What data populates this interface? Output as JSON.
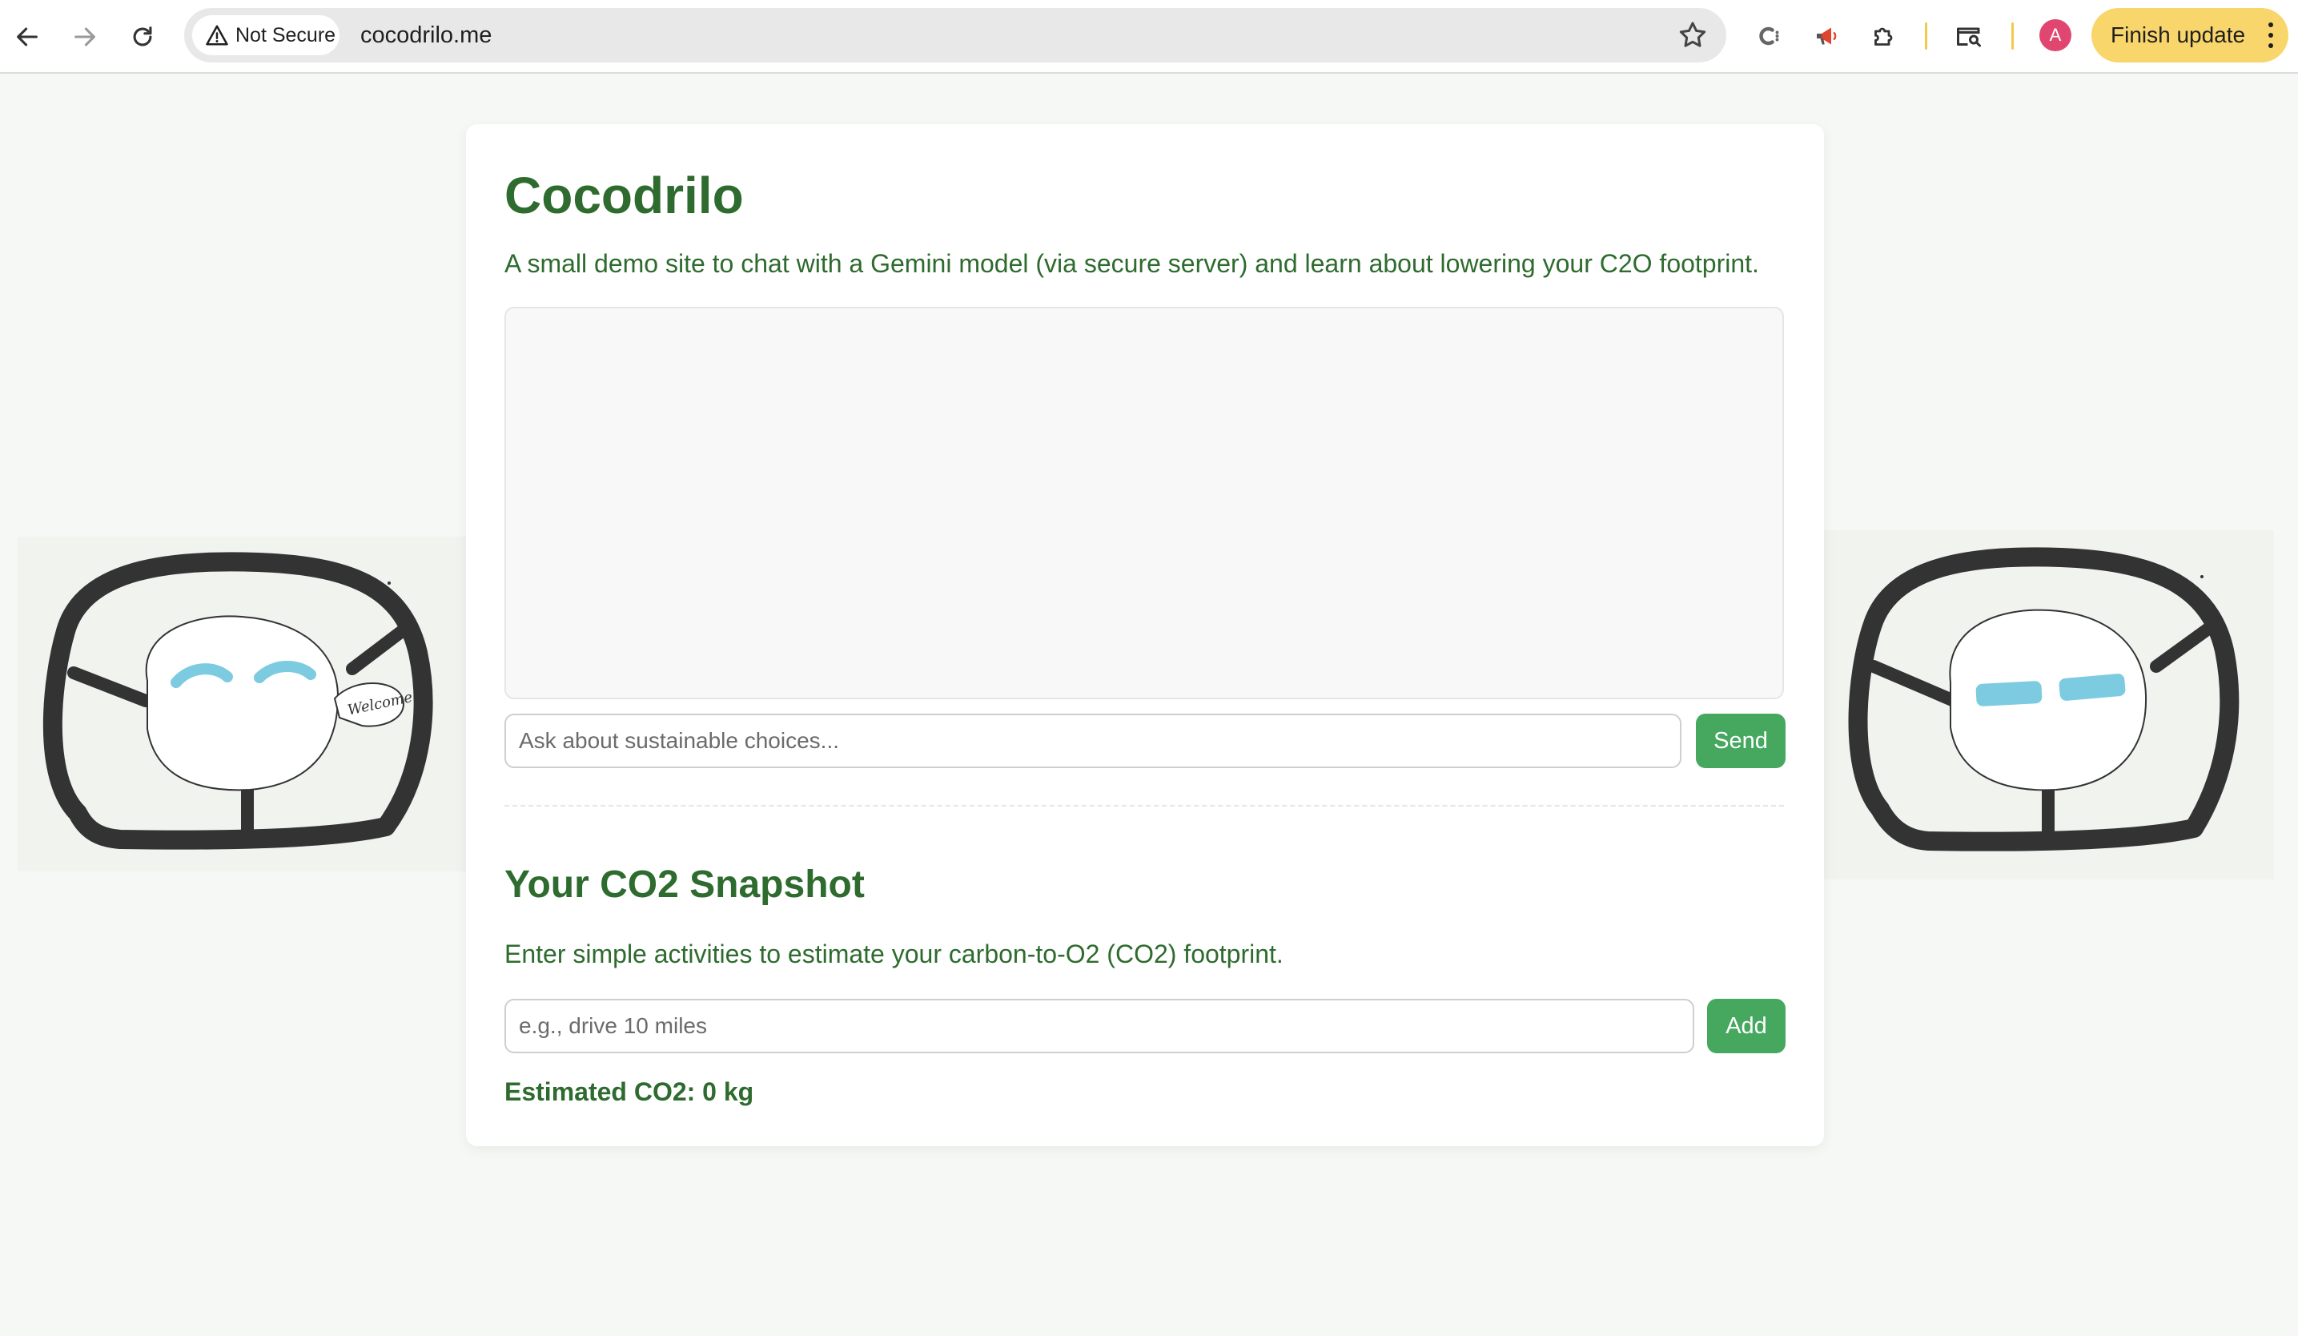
{
  "browser": {
    "security_label": "Not Secure",
    "url": "cocodrilo.me",
    "finish_update_label": "Finish update",
    "profile_initial": "A"
  },
  "page": {
    "title": "Cocodrilo",
    "subtitle": "A small demo site to chat with a Gemini model (via secure server) and learn about lowering your C2O footprint.",
    "chat": {
      "input_placeholder": "Ask about sustainable choices...",
      "input_value": "",
      "send_label": "Send"
    },
    "snapshot": {
      "title": "Your CO2 Snapshot",
      "subtitle": "Enter simple activities to estimate your carbon-to-O2 (CO2) footprint.",
      "input_placeholder": "e.g., drive 10 miles",
      "input_value": "",
      "add_label": "Add",
      "estimate_text": "Estimated CO2: 0 kg"
    },
    "illustrations": {
      "left_bubble_text": "Welcome"
    }
  },
  "colors": {
    "accent_green": "#45a85e",
    "heading_green": "#2e6b2e",
    "update_yellow": "#f9d66b",
    "eye_blue": "#7ccbe0"
  },
  "icons": {
    "back": "arrow-left-icon",
    "forward": "arrow-right-icon",
    "reload": "reload-icon",
    "warning": "warning-icon",
    "bookmark": "star-icon",
    "extensions": "puzzle-icon"
  }
}
